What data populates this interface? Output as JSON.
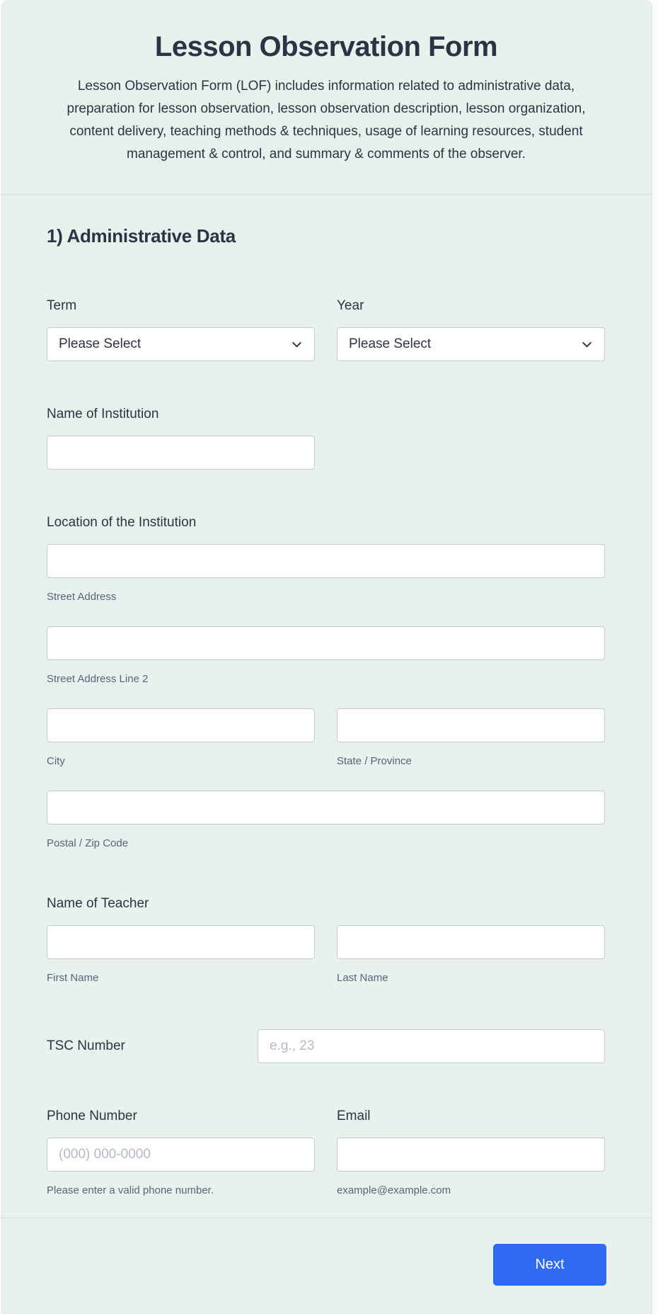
{
  "header": {
    "title": "Lesson Observation Form",
    "description": "Lesson Observation Form (LOF) includes information related to administrative data, preparation for lesson observation, lesson observation description, lesson organization, content delivery, teaching methods & techniques, usage of learning resources, student management & control, and summary & comments of the observer."
  },
  "section": {
    "heading": "1) Administrative Data"
  },
  "fields": {
    "term": {
      "label": "Term",
      "value": "Please Select"
    },
    "year": {
      "label": "Year",
      "value": "Please Select"
    },
    "institution": {
      "label": "Name of Institution",
      "value": ""
    },
    "location": {
      "label": "Location of the Institution",
      "street": {
        "sublabel": "Street Address",
        "value": ""
      },
      "street2": {
        "sublabel": "Street Address Line 2",
        "value": ""
      },
      "city": {
        "sublabel": "City",
        "value": ""
      },
      "state": {
        "sublabel": "State / Province",
        "value": ""
      },
      "postal": {
        "sublabel": "Postal / Zip Code",
        "value": ""
      }
    },
    "teacher": {
      "label": "Name of Teacher",
      "first": {
        "sublabel": "First Name",
        "value": ""
      },
      "last": {
        "sublabel": "Last Name",
        "value": ""
      }
    },
    "tsc": {
      "label": "TSC Number",
      "placeholder": "e.g., 23",
      "value": ""
    },
    "phone": {
      "label": "Phone Number",
      "placeholder": "(000) 000-0000",
      "helper": "Please enter a valid phone number.",
      "value": ""
    },
    "email": {
      "label": "Email",
      "helper": "example@example.com",
      "value": ""
    }
  },
  "footer": {
    "next_label": "Next"
  },
  "icons": {
    "select_chevron": "chevron-down"
  },
  "colors": {
    "accent": "#2e6bf2",
    "text": "#2c3345",
    "subtext": "#57647e",
    "card_bg": "#e9f1ec",
    "input_border": "#c3cad5",
    "divider": "#d6dbde"
  }
}
